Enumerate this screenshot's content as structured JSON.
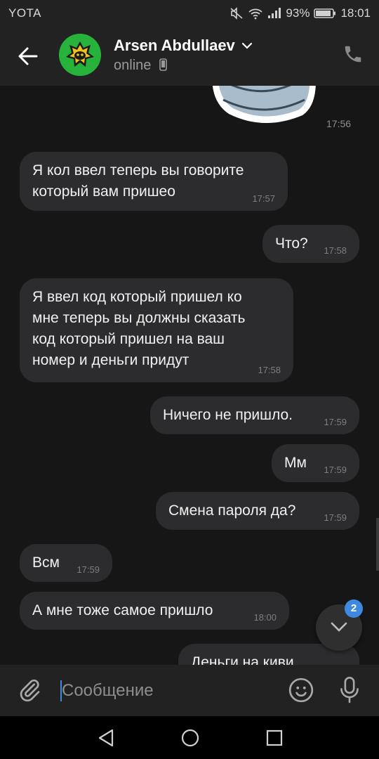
{
  "status_bar": {
    "carrier": "YOTA",
    "battery": "93%",
    "time": "18:01",
    "icons": [
      "mute-icon",
      "wifi-icon",
      "signal-icon",
      "battery-icon"
    ]
  },
  "header": {
    "contact_name": "Arsen Abdullaev",
    "status": "online",
    "icons": [
      "back-arrow-icon",
      "chevron-down-icon",
      "mobile-icon",
      "phone-icon"
    ]
  },
  "sticker": {
    "time": "17:56"
  },
  "messages": [
    {
      "direction": "incoming",
      "text": "Я кол ввел теперь вы говорите\nкоторый вам пришео",
      "time": "17:57"
    },
    {
      "direction": "outgoing",
      "text": "Что?",
      "time": "17:58"
    },
    {
      "direction": "incoming",
      "text": "Я ввел код который пришел ко\nмне теперь вы должны сказать\nкод который пришел на ваш\nномер и деньги придут",
      "time": "17:58"
    },
    {
      "direction": "outgoing",
      "text": "Ничего не пришло.",
      "time": "17:59"
    },
    {
      "direction": "outgoing",
      "text": "Мм",
      "time": "17:59"
    },
    {
      "direction": "outgoing",
      "text": "Смена пароля да?",
      "time": "17:59"
    },
    {
      "direction": "incoming",
      "text": "Всм",
      "time": "17:59"
    },
    {
      "direction": "incoming",
      "text": "А мне тоже самое пришло",
      "time": "18:00"
    },
    {
      "direction": "outgoing",
      "text": "Деньги на киви",
      "time": ""
    }
  ],
  "scroll_down": {
    "unread_count": "2"
  },
  "composer": {
    "placeholder": "Сообщение"
  },
  "colors": {
    "accent": "#3f8ae0",
    "bubble": "#2c2c2e",
    "background": "#161616",
    "bar": "#222222"
  }
}
